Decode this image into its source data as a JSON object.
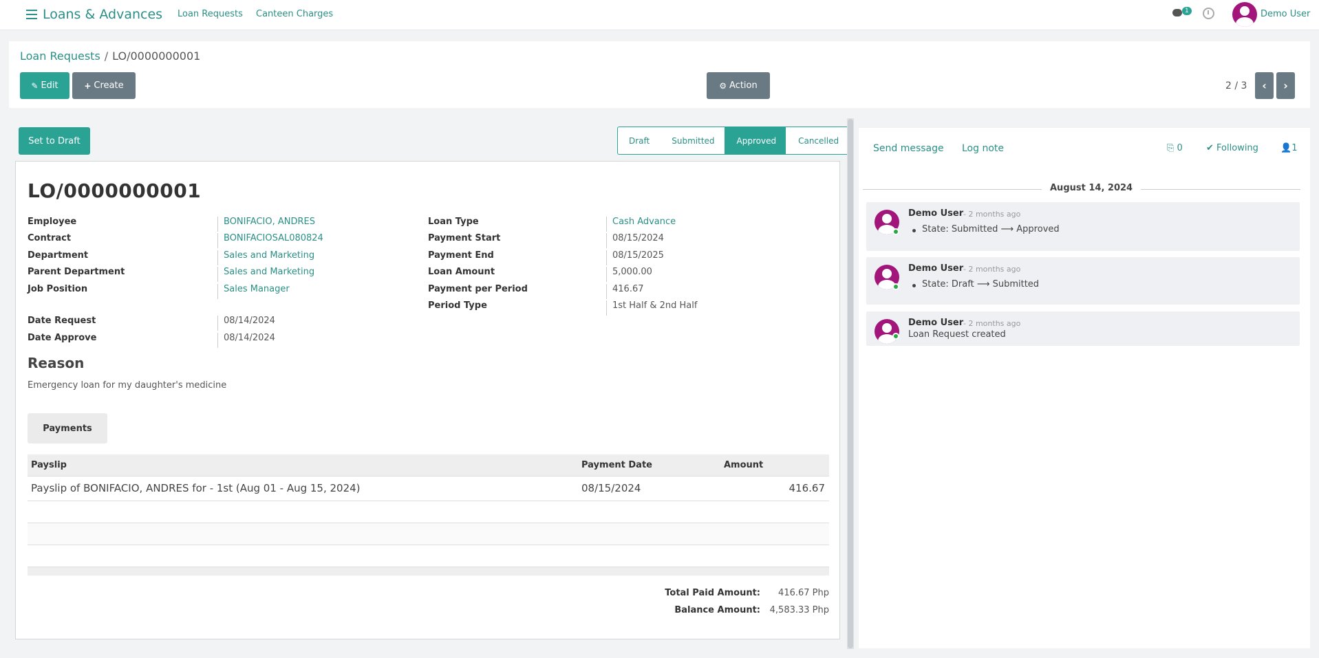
{
  "navbar": {
    "app_title": "Loans & Advances",
    "links": [
      "Loan Requests",
      "Canteen Charges"
    ],
    "chat_badge": "1",
    "user_name": "Demo User"
  },
  "breadcrumb": {
    "parent": "Loan Requests",
    "separator": "/",
    "current": "LO/0000000001"
  },
  "toolbar": {
    "edit_label": "Edit",
    "create_label": "Create",
    "action_label": "Action",
    "pager": "2 / 3"
  },
  "statusbar": {
    "set_draft_label": "Set to Draft",
    "steps": [
      "Draft",
      "Submitted",
      "Approved",
      "Cancelled"
    ],
    "active_step": "Approved"
  },
  "record": {
    "title": "LO/0000000001",
    "left_fields": [
      {
        "label": "Employee",
        "value": "BONIFACIO, ANDRES"
      },
      {
        "label": "Contract",
        "value": "BONIFACIOSAL080824"
      },
      {
        "label": "Department",
        "value": "Sales and Marketing"
      },
      {
        "label": "Parent Department",
        "value": "Sales and Marketing"
      },
      {
        "label": "Job Position",
        "value": "Sales Manager"
      }
    ],
    "date_fields": [
      {
        "label": "Date Request",
        "value": "08/14/2024"
      },
      {
        "label": "Date Approve",
        "value": "08/14/2024"
      }
    ],
    "right_fields": [
      {
        "label": "Loan Type",
        "value": "Cash Advance"
      },
      {
        "label": "Payment Start",
        "value": "08/15/2024"
      },
      {
        "label": "Payment End",
        "value": "08/15/2025"
      },
      {
        "label": "Loan Amount",
        "value": "5,000.00"
      },
      {
        "label": "Payment per Period",
        "value": "416.67"
      },
      {
        "label": "Period Type",
        "value": "1st Half & 2nd Half"
      }
    ],
    "reason_heading": "Reason",
    "reason_text": "Emergency loan for my daughter's medicine"
  },
  "payments": {
    "tab_label": "Payments",
    "columns": [
      "Payslip",
      "Payment Date",
      "Amount"
    ],
    "rows": [
      {
        "payslip": "Payslip of BONIFACIO, ANDRES for - 1st (Aug 01 - Aug 15, 2024)",
        "date": "08/15/2024",
        "amount": "416.67"
      }
    ],
    "total_paid_label": "Total Paid Amount:",
    "total_paid_value": "416.67 Php",
    "balance_label": "Balance Amount:",
    "balance_value": "4,583.33 Php"
  },
  "chatter": {
    "send_message": "Send message",
    "log_note": "Log note",
    "attachments": "0",
    "following": "Following",
    "followers": "1",
    "date_divider": "August 14, 2024",
    "messages": [
      {
        "author": "Demo User",
        "time": "- 2 months ago",
        "body": "State: Submitted ⟶ Approved",
        "bullet": true
      },
      {
        "author": "Demo User",
        "time": "- 2 months ago",
        "body": "State: Draft ⟶ Submitted",
        "bullet": true
      },
      {
        "author": "Demo User",
        "time": "- 2 months ago",
        "body": "Loan Request created",
        "bullet": false
      }
    ]
  },
  "colors": {
    "primary": "#2aa395",
    "link": "#2a8f86",
    "secondary": "#6a7a84",
    "avatar": "#a2157a"
  }
}
